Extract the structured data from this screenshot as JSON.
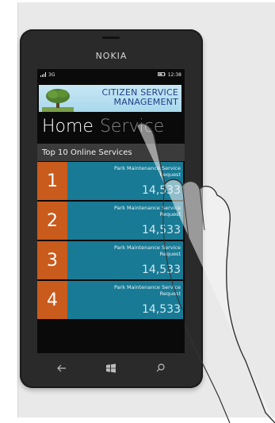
{
  "device": {
    "brand": "NOKIA"
  },
  "status_bar": {
    "network": "3G",
    "time": "12:38"
  },
  "banner": {
    "line1": "CITIZEN SERVICE",
    "line2": "MANAGEMENT"
  },
  "pivot": {
    "active": "Home",
    "inactive": "Service"
  },
  "section": {
    "title": "Top 10 Online Services"
  },
  "services": [
    {
      "rank": "1",
      "name": "Park Maintenance Service Request",
      "count": "14,533"
    },
    {
      "rank": "2",
      "name": "Park Maintenance Service Request",
      "count": "14,533"
    },
    {
      "rank": "3",
      "name": "Park Maintenance Service Request",
      "count": "14,533"
    },
    {
      "rank": "4",
      "name": "Park Maintenance Service Request",
      "count": "14,533"
    }
  ],
  "nav_icons": [
    "back-icon",
    "windows-icon",
    "search-icon"
  ],
  "colors": {
    "rank_tile": "#c95b1c",
    "info_tile": "#187a95",
    "banner_text": "#1f3f8a"
  }
}
